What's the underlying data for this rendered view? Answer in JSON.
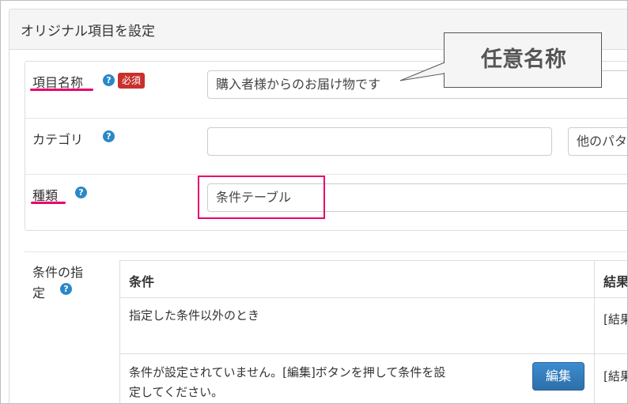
{
  "panel": {
    "title": "オリジナル項目を設定"
  },
  "callout": {
    "text": "任意名称"
  },
  "fields": {
    "name": {
      "label": "項目名称",
      "required": "必須",
      "value": "購入者様からのお届け物です",
      "help": "?"
    },
    "category": {
      "label": "カテゴリ",
      "value": "",
      "help": "?",
      "other_pattern": "他のパタ"
    },
    "type": {
      "label": "種類",
      "value": "条件テーブル",
      "help": "?"
    }
  },
  "conditions": {
    "label_line1": "条件の指",
    "label_line2": "定",
    "help": "?",
    "columns": [
      "条件",
      "結果"
    ],
    "rows": [
      {
        "condition": "指定した条件以外のとき",
        "result": "[結果"
      },
      {
        "condition_line1": "条件が設定されていません。[編集]ボタンを押して条件を設",
        "condition_line2": "定してください。",
        "button": "編集",
        "result": "[結果"
      }
    ]
  },
  "colors": {
    "accent": "#e8006f",
    "help": "#2a88c8",
    "required": "#c9302c",
    "button": "#337ab7"
  }
}
